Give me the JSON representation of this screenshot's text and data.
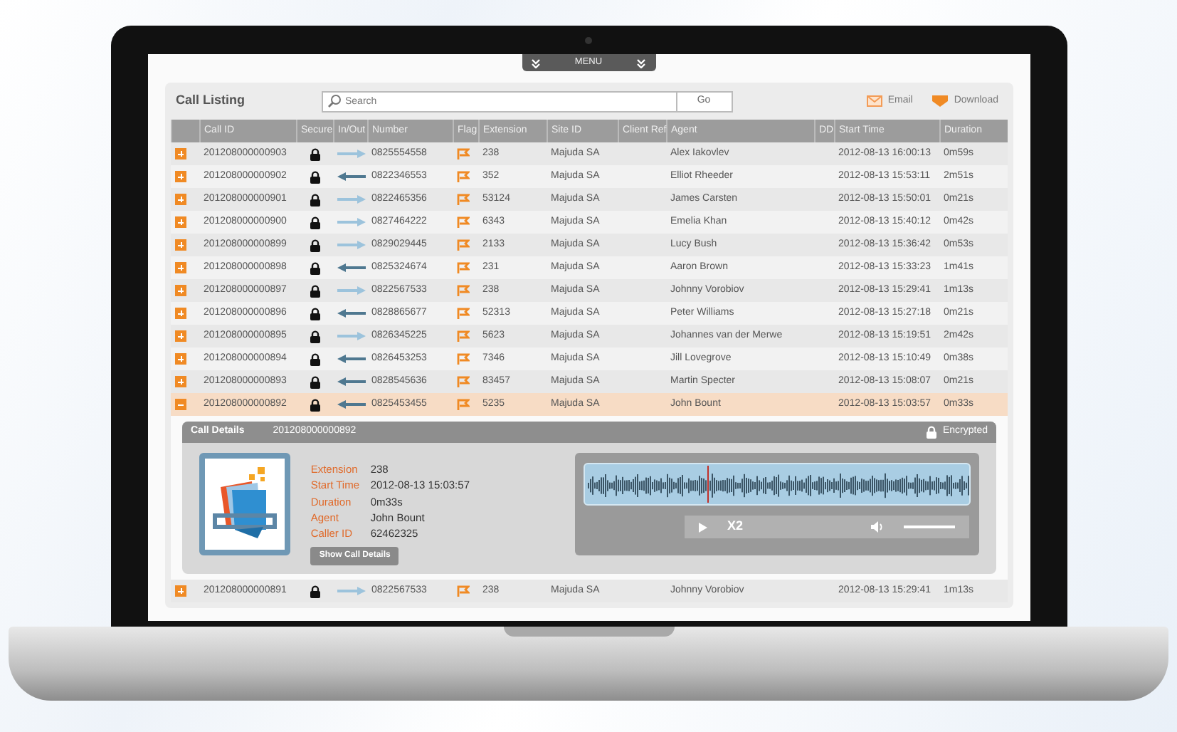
{
  "menu": {
    "label": "MENU"
  },
  "listing": {
    "title": "Call Listing",
    "search": {
      "placeholder": "Search"
    },
    "go": "Go",
    "email": "Email",
    "download": "Download"
  },
  "table": {
    "columns": [
      "Call ID",
      "Secure",
      "In/Out",
      "Number",
      "Flag",
      "Extension",
      "Site ID",
      "Client Ref",
      "Agent",
      "DD",
      "Start Time",
      "Duration"
    ],
    "rows": [
      {
        "call_id": "201208000000903",
        "secure": true,
        "kind": "out",
        "number": "0825554558",
        "flagged": true,
        "extension": "238",
        "site_id": "Majuda SA",
        "agent": "Alex Iakovlev",
        "start_time": "2012-08-13  16:00:13",
        "duration": "0m59s",
        "expanded": false
      },
      {
        "call_id": "201208000000902",
        "secure": true,
        "kind": "in",
        "number": "0822346553",
        "flagged": true,
        "extension": "352",
        "site_id": "Majuda SA",
        "agent": "Elliot Rheeder",
        "start_time": "2012-08-13  15:53:11",
        "duration": "2m51s",
        "expanded": false
      },
      {
        "call_id": "201208000000901",
        "secure": true,
        "kind": "out",
        "number": "0822465356",
        "flagged": true,
        "extension": "53124",
        "site_id": "Majuda SA",
        "agent": "James Carsten",
        "start_time": "2012-08-13  15:50:01",
        "duration": "0m21s",
        "expanded": false
      },
      {
        "call_id": "201208000000900",
        "secure": true,
        "kind": "out",
        "number": "0827464222",
        "flagged": true,
        "extension": "6343",
        "site_id": "Majuda SA",
        "agent": "Emelia Khan",
        "start_time": "2012-08-13  15:40:12",
        "duration": "0m42s",
        "expanded": false
      },
      {
        "call_id": "201208000000899",
        "secure": true,
        "kind": "out",
        "number": "0829029445",
        "flagged": true,
        "extension": "2133",
        "site_id": "Majuda SA",
        "agent": "Lucy Bush",
        "start_time": "2012-08-13 15:36:42",
        "duration": "0m53s",
        "expanded": false
      },
      {
        "call_id": "201208000000898",
        "secure": true,
        "kind": "in",
        "number": "0825324674",
        "flagged": true,
        "extension": "231",
        "site_id": "Majuda SA",
        "agent": "Aaron Brown",
        "start_time": "2012-08-13  15:33:23",
        "duration": "1m41s",
        "expanded": false
      },
      {
        "call_id": "201208000000897",
        "secure": true,
        "kind": "out",
        "number": "0822567533",
        "flagged": true,
        "extension": "238",
        "site_id": "Majuda SA",
        "agent": "Johnny Vorobiov",
        "start_time": "2012-08-13  15:29:41",
        "duration": "1m13s",
        "expanded": false
      },
      {
        "call_id": "201208000000896",
        "secure": true,
        "kind": "in",
        "number": "0828865677",
        "flagged": true,
        "extension": "52313",
        "site_id": "Majuda SA",
        "agent": "Peter Williams",
        "start_time": "2012-08-13  15:27:18",
        "duration": "0m21s",
        "expanded": false
      },
      {
        "call_id": "201208000000895",
        "secure": true,
        "kind": "out",
        "number": "0826345225",
        "flagged": true,
        "extension": "5623",
        "site_id": "Majuda SA",
        "agent": "Johannes van der Merwe",
        "start_time": "2012-08-13  15:19:51",
        "duration": "2m42s",
        "expanded": false
      },
      {
        "call_id": "201208000000894",
        "secure": true,
        "kind": "in",
        "number": "0826453253",
        "flagged": true,
        "extension": "7346",
        "site_id": "Majuda SA",
        "agent": "Jill Lovegrove",
        "start_time": "2012-08-13  15:10:49",
        "duration": "0m38s",
        "expanded": false
      },
      {
        "call_id": "201208000000893",
        "secure": true,
        "kind": "in",
        "number": "0828545636",
        "flagged": true,
        "extension": "83457",
        "site_id": "Majuda SA",
        "agent": "Martin Specter",
        "start_time": "2012-08-13  15:08:07",
        "duration": "0m21s",
        "expanded": false
      },
      {
        "call_id": "201208000000892",
        "secure": true,
        "kind": "in",
        "number": "0825453455",
        "flagged": true,
        "extension": "5235",
        "site_id": "Majuda SA",
        "agent": "John Bount",
        "start_time": "2012-08-13  15:03:57",
        "duration": "0m33s",
        "expanded": true
      },
      {
        "call_id": "201208000000891",
        "secure": true,
        "kind": "out",
        "number": "0822567533",
        "flagged": true,
        "extension": "238",
        "site_id": "Majuda SA",
        "agent": "Johnny Vorobiov",
        "start_time": "2012-08-13  15:29:41",
        "duration": "1m13s",
        "expanded": false
      }
    ]
  },
  "details": {
    "title": "Call Details",
    "call_id": "201208000000892",
    "encrypted": "Encrypted",
    "fields": [
      {
        "label": "Extension",
        "value": "238"
      },
      {
        "label": "Start Time",
        "value": "2012-08-13  15:03:57"
      },
      {
        "label": "Duration",
        "value": "0m33s"
      },
      {
        "label": "Agent",
        "value": "John Bount"
      },
      {
        "label": "Caller ID",
        "value": "62462325"
      }
    ],
    "button": "Show Call Details",
    "player": {
      "level": 0.32,
      "speed": "X2",
      "volume": {
        "level": 1
      }
    }
  }
}
